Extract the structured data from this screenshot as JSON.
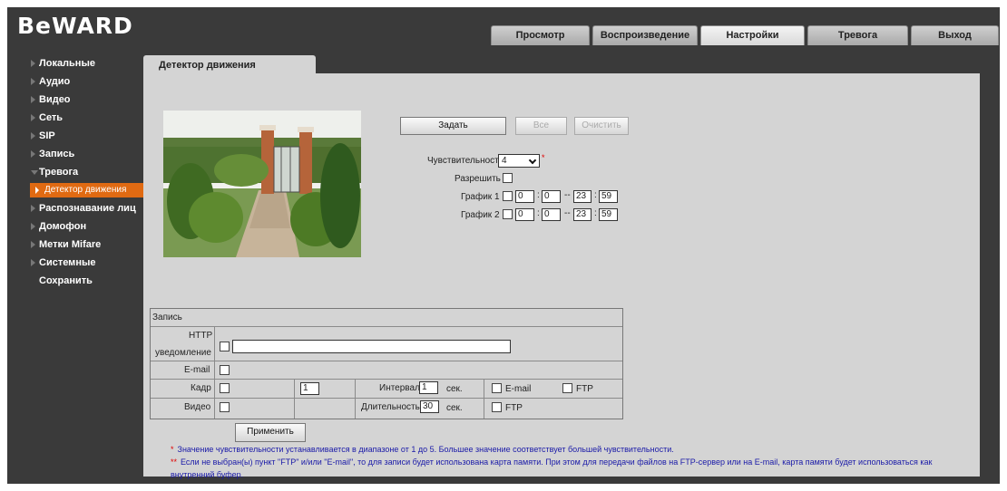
{
  "header": {
    "logo_text": "BeWARD",
    "tabs": [
      {
        "label": "Просмотр",
        "active": false
      },
      {
        "label": "Воспроизведение",
        "active": false
      },
      {
        "label": "Настройки",
        "active": true
      },
      {
        "label": "Тревога",
        "active": false
      },
      {
        "label": "Выход",
        "active": false
      }
    ]
  },
  "sidebar": {
    "items": [
      {
        "label": "Локальные"
      },
      {
        "label": "Аудио"
      },
      {
        "label": "Видео"
      },
      {
        "label": "Сеть"
      },
      {
        "label": "SIP"
      },
      {
        "label": "Запись"
      },
      {
        "label": "Тревога",
        "expanded": true
      },
      {
        "label": "Распознавание лиц"
      },
      {
        "label": "Домофон"
      },
      {
        "label": "Метки Mifare"
      },
      {
        "label": "Системные"
      },
      {
        "label": "Сохранить"
      }
    ],
    "sub_item": {
      "label": "Детектор движения",
      "selected": true
    }
  },
  "page": {
    "tab_title": "Детектор движения"
  },
  "controls": {
    "set_button": "Задать",
    "all_button": "Все",
    "clear_button": "Очистить",
    "sensitivity_label": "Чувствительность",
    "sensitivity_value": "4",
    "sensitivity_mark": "*",
    "enable_label": "Разрешить",
    "schedule1_label": "График 1",
    "schedule2_label": "График 2",
    "schedule1": {
      "h1": "0",
      "m1": "0",
      "h2": "23",
      "m2": "59"
    },
    "schedule2": {
      "h1": "0",
      "m1": "0",
      "h2": "23",
      "m2": "59"
    },
    "colon": ":",
    "dash": "--"
  },
  "record_table": {
    "header": "Запись",
    "http_label_1": "HTTP",
    "http_label_2": "уведомление",
    "http_value": "",
    "email_label": "E-mail",
    "frame_label": "Кадр",
    "frame_count": "1",
    "interval_label": "Интервал",
    "interval_value": "1",
    "sec_label": "сек.",
    "email_opt": "E-mail",
    "ftp_opt": "FTP",
    "video_label": "Видео",
    "duration_label": "Длительность",
    "duration_value": "30",
    "sec_label_2": "сек.",
    "ftp_opt_2": "FTP"
  },
  "apply_button": "Применить",
  "notes": {
    "note1_mark": "*",
    "note1": "Значение чувствительности устанавливается в диапазоне от 1 до 5. Большее значение соответствует большей чувствительности.",
    "note2_mark": "**",
    "note2_line1": "Если не выбран(ы) пункт \"FTP\" и/или \"E-mail\", то для записи будет использована карта памяти. При этом для передачи файлов на FTP-сервер или на E-mail, карта памяти будет использоваться как",
    "note2_line2": "внутренний буфер."
  },
  "colors": {
    "frame_bg": "#3a3a3a",
    "content_bg": "#d4d4d4",
    "selected_item": "#e06a12",
    "note_text": "#1a1aa8",
    "required_mark": "#e00000"
  }
}
